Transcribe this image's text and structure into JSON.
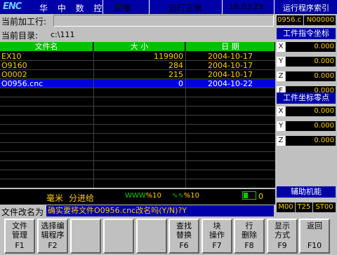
{
  "header": {
    "logo": "ENC",
    "brand": "华 中 数 控",
    "mode": "回零",
    "status": "运行正常",
    "time": "16:03:29"
  },
  "current_label": "当前加工行:",
  "current_value": "",
  "dir_label": "当前目录:",
  "dir_value": "c:\\111",
  "table": {
    "columns": [
      "文件名",
      "大 小",
      "日 期"
    ],
    "rows": [
      {
        "name": "EX10",
        "size": "119900",
        "date": "2004-10-17"
      },
      {
        "name": "O9160",
        "size": "284",
        "date": "2004-10-17"
      },
      {
        "name": "O0002",
        "size": "215",
        "date": "2004-10-17"
      },
      {
        "name": "O0956.cnc",
        "size": "0",
        "date": "2004-10-22"
      }
    ]
  },
  "bottom": {
    "unit": "毫米",
    "feed_mode": "分进给",
    "feed_icon": "feed-override-icon",
    "feed_pct": "%10",
    "spindle_pct": "%10",
    "rapid_value": "0"
  },
  "prompt_label": "文件改名为",
  "prompt_text": "确实要将文件O0956.cnc改名吗(Y/N)?Y",
  "right": {
    "section1_title": "运行程序索引",
    "prog_name": "0956.c",
    "prog_line": "N00000",
    "section2_title": "工件指令坐标",
    "cmd_coords": [
      {
        "axis": "X",
        "value": "0.000"
      },
      {
        "axis": "Y",
        "value": "0.000"
      },
      {
        "axis": "Z",
        "value": "0.000"
      },
      {
        "axis": "F",
        "value": "0.000"
      }
    ],
    "section3_title": "工件坐标零点",
    "zero_coords": [
      {
        "axis": "X",
        "value": "0.000"
      },
      {
        "axis": "Y",
        "value": "0.000"
      },
      {
        "axis": "Z",
        "value": "0.000"
      }
    ],
    "aux_title": "辅助机能",
    "aux_m": "M00",
    "aux_t": "T25",
    "aux_st": "ST00"
  },
  "softkeys": [
    {
      "line1": "文件",
      "line2": "管理",
      "fk": "F1"
    },
    {
      "line1": "选择编",
      "line2": "辑程序",
      "fk": "F2"
    },
    {
      "line1": "",
      "line2": "",
      "fk": ""
    },
    {
      "line1": "",
      "line2": "",
      "fk": ""
    },
    {
      "line1": "",
      "line2": "",
      "fk": ""
    },
    {
      "line1": "查找",
      "line2": "替换",
      "fk": "F6"
    },
    {
      "line1": "块",
      "line2": "操作",
      "fk": "F7"
    },
    {
      "line1": "行",
      "line2": "删除",
      "fk": "F8"
    },
    {
      "line1": "显示",
      "line2": "方式",
      "fk": "F9"
    },
    {
      "line1": "返回",
      "line2": "",
      "fk": "F10"
    }
  ]
}
